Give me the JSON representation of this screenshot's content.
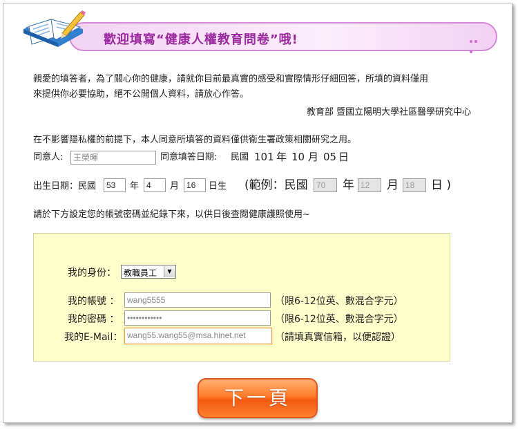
{
  "header": {
    "title": "歡迎填寫“健康人權教育問卷”哦!"
  },
  "intro": {
    "line1": "親愛的填答者，為了關心你的健康，請就你目前最真實的感受和實際情形仔細回答，所填的資料僅用",
    "line2": "來提供你必要協助，絕不公開個人資料，請放心作答。",
    "signature": "教育部 暨國立陽明大學社區醫學研究中心"
  },
  "consent": {
    "statement": "在不影響隱私權的前提下，本人同意所填答的資料僅供衛生署政策相關研究之用。",
    "signer_label": "同意人:",
    "signer_value": "王榮暉",
    "date_label": "同意填答日期:",
    "date_era": "民國",
    "date_year": "101",
    "year_unit": "年",
    "date_month": "10",
    "month_unit": "月",
    "date_day": "05",
    "day_unit": "日"
  },
  "birth": {
    "label": "出生日期：民國",
    "year": "53",
    "year_unit": "年",
    "month": "4",
    "month_unit": "月",
    "day": "16",
    "day_unit": "日生",
    "example_prefix": "(範例：民國",
    "example_year": "70",
    "example_year_unit": "年",
    "example_month": "12",
    "example_month_unit": "月",
    "example_day": "18",
    "example_suffix": "日 )"
  },
  "instruction": "請於下方設定您的帳號密碼並紀錄下來，以供日後查閱健康護照使用~",
  "form": {
    "identity_label": "我的身份：",
    "identity_selected": "教職員工",
    "account_label": "我的帳號 ：",
    "account_value": "wang5555",
    "account_hint": "（限6-12位英、數混合字元）",
    "password_label": "我的密碼 ：",
    "password_value": "••••••••••••",
    "password_hint": "（限6-12位英、數混合字元）",
    "email_label": "我的E-Mail：",
    "email_value": "wang55.wang55@msa.hinet.net",
    "email_hint": "（請填真實信箱，以便認證）"
  },
  "next_button": "下一頁",
  "colors": {
    "banner_border": "#d48ad8",
    "banner_text": "#9b2a9e",
    "form_bg": "#ffffcc",
    "button_orange": "#ff7a2b"
  }
}
